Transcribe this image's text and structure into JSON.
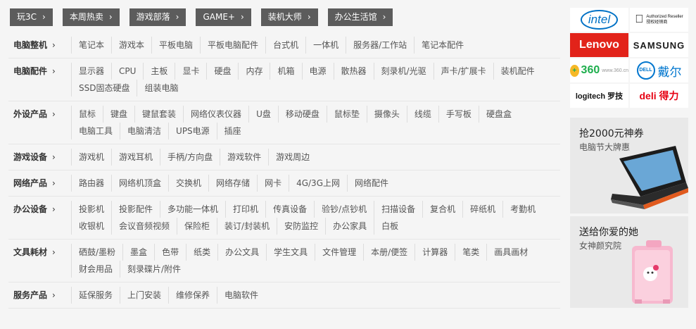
{
  "top_tags": [
    "玩3C",
    "本周热卖",
    "游戏部落",
    "GAME+",
    "装机大师",
    "办公生活馆"
  ],
  "categories": [
    {
      "title": "电脑整机",
      "items": [
        "笔记本",
        "游戏本",
        "平板电脑",
        "平板电脑配件",
        "台式机",
        "一体机",
        "服务器/工作站",
        "笔记本配件"
      ]
    },
    {
      "title": "电脑配件",
      "items": [
        "显示器",
        "CPU",
        "主板",
        "显卡",
        "硬盘",
        "内存",
        "机箱",
        "电源",
        "散热器",
        "刻录机/光驱",
        "声卡/扩展卡",
        "装机配件",
        "SSD固态硬盘",
        "组装电脑"
      ]
    },
    {
      "title": "外设产品",
      "items": [
        "鼠标",
        "键盘",
        "键鼠套装",
        "网络仪表仪器",
        "U盘",
        "移动硬盘",
        "鼠标垫",
        "摄像头",
        "线缆",
        "手写板",
        "硬盘盒",
        "电脑工具",
        "电脑清洁",
        "UPS电源",
        "插座"
      ]
    },
    {
      "title": "游戏设备",
      "items": [
        "游戏机",
        "游戏耳机",
        "手柄/方向盘",
        "游戏软件",
        "游戏周边"
      ]
    },
    {
      "title": "网络产品",
      "items": [
        "路由器",
        "网络机顶盒",
        "交换机",
        "网络存储",
        "网卡",
        "4G/3G上网",
        "网络配件"
      ]
    },
    {
      "title": "办公设备",
      "items": [
        "投影机",
        "投影配件",
        "多功能一体机",
        "打印机",
        "传真设备",
        "验钞/点钞机",
        "扫描设备",
        "复合机",
        "碎纸机",
        "考勤机",
        "收银机",
        "会议音频视频",
        "保险柜",
        "装订/封装机",
        "安防监控",
        "办公家具",
        "白板"
      ]
    },
    {
      "title": "文具耗材",
      "items": [
        "硒鼓/墨粉",
        "墨盒",
        "色带",
        "纸类",
        "办公文具",
        "学生文具",
        "文件管理",
        "本册/便签",
        "计算器",
        "笔类",
        "画具画材",
        "财会用品",
        "刻录碟片/附件"
      ]
    },
    {
      "title": "服务产品",
      "items": [
        "延保服务",
        "上门安装",
        "维修保养",
        "电脑软件"
      ]
    }
  ],
  "brands": {
    "intel": "intel",
    "apple_line1": "Authorized Reseller",
    "apple_line2": "授权经销商",
    "lenovo": "Lenovo",
    "samsung": "SAMSUNG",
    "b360": "360",
    "b360_sub": "www.360.cn",
    "dell_mark": "DELL",
    "dell_cn": "戴尔",
    "logitech": "logitech 罗技",
    "deli": "deli 得力"
  },
  "promos": [
    {
      "title": "抢2000元神券",
      "subtitle": "电脑节大牌惠"
    },
    {
      "title": "送给你爱的她",
      "subtitle": "女神颜究院"
    }
  ],
  "colors": {
    "tag_bg": "#5c5c5c",
    "lenovo_red": "#e2231a",
    "intel_blue": "#0071c5",
    "dell_blue": "#0076ce",
    "green_360": "#1eae4d",
    "deli_red": "#e60012"
  }
}
